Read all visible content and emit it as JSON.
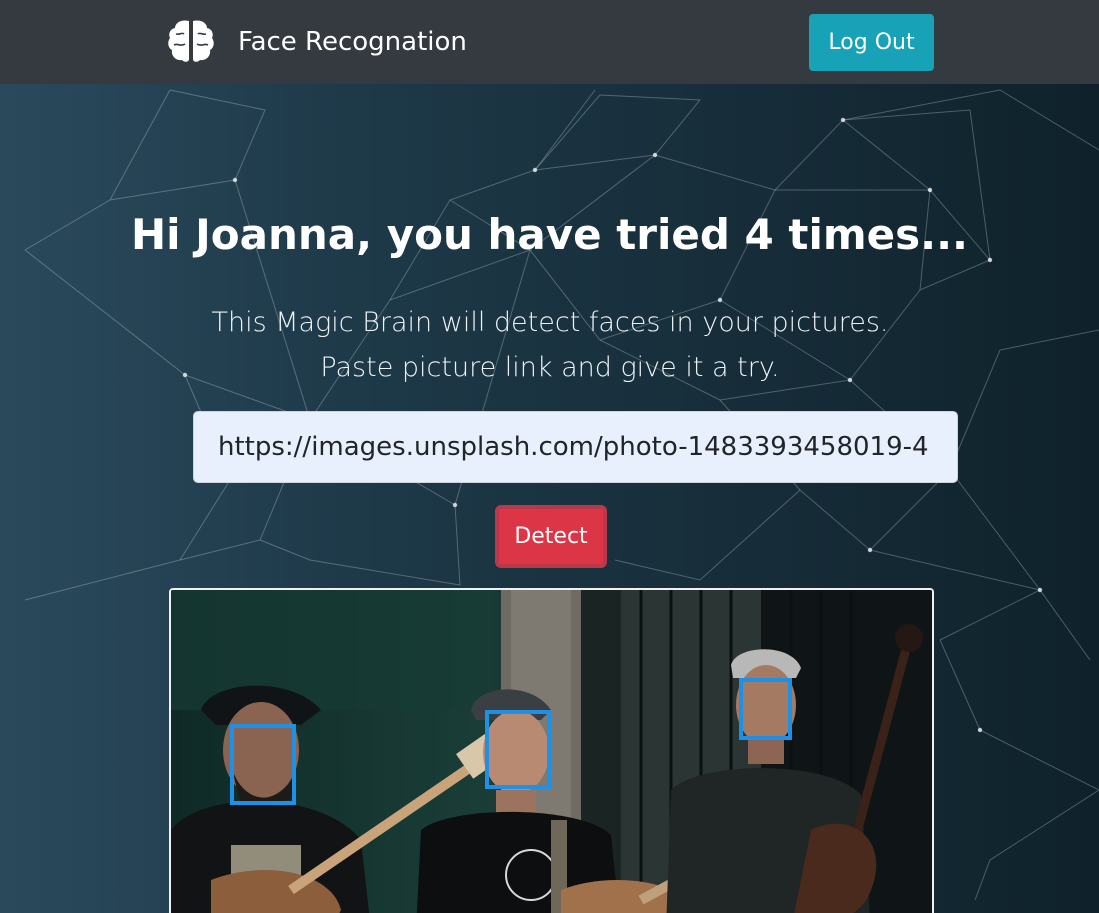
{
  "nav": {
    "brand_title": "Face Recognation",
    "logout_label": "Log Out",
    "brand_icon": "brain-icon"
  },
  "hero": {
    "greeting": "Hi Joanna, you have tried 4 times...",
    "intro": "This Magic Brain will detect faces in your pictures. Paste picture link and give it a try."
  },
  "form": {
    "url_value": "https://images.unsplash.com/photo-1483393458019-4",
    "detect_label": "Detect"
  },
  "result": {
    "faces_detected": 3
  },
  "colors": {
    "navbar": "#343a40",
    "logout_button": "#17a2b8",
    "detect_button": "#dc3545",
    "face_box": "#1e90e6"
  }
}
